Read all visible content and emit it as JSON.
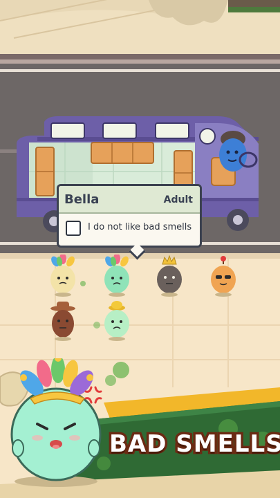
{
  "tooltip": {
    "name": "Bella",
    "age_group": "Adult",
    "trait_text": "I do not like bad smells",
    "trait_checked": false
  },
  "banner": {
    "title": "BAD SMELLS"
  },
  "colors": {
    "street": "#6d6766",
    "sidewalk": "#f7e6c8",
    "bus_body": "#6d5fa8",
    "banner_green": "#2f6a34",
    "banner_yellow": "#f2b72a",
    "banner_text_outline": "#6b2a13",
    "stink_green": "#5fb04a"
  },
  "icons": [
    "jester-hat-icon",
    "cowboy-hat-icon",
    "crown-icon",
    "angry-vein-icon",
    "stink-cloud-icon",
    "steering-wheel-icon"
  ]
}
